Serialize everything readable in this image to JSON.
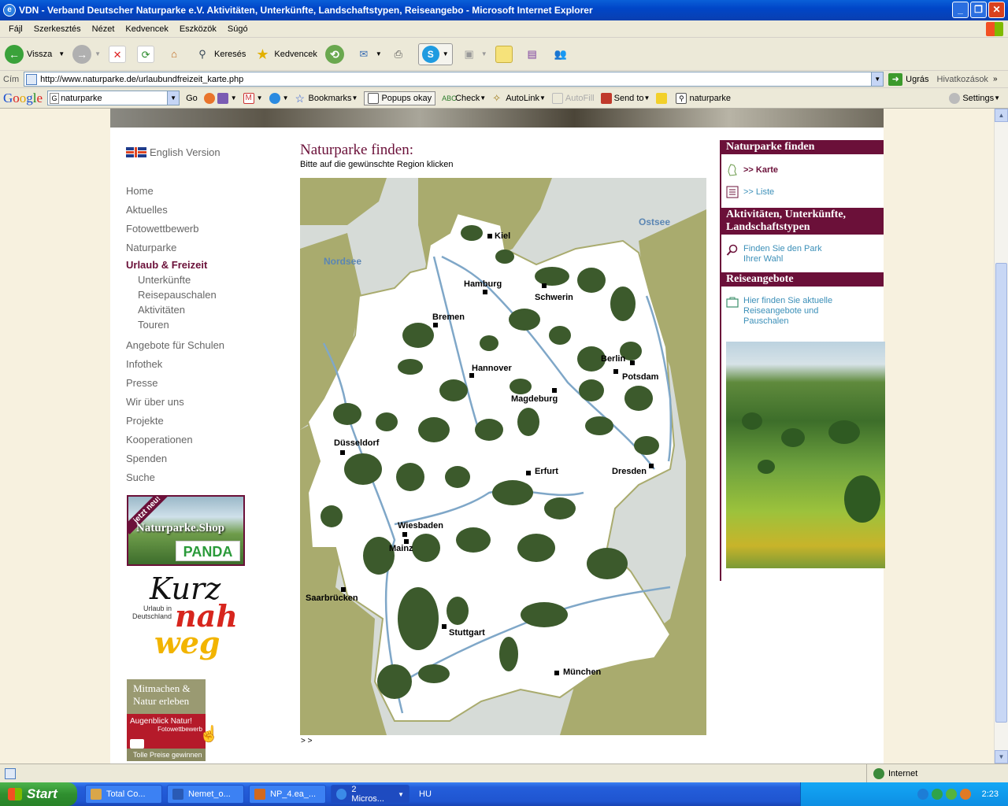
{
  "window": {
    "title": "VDN - Verband Deutscher Naturparke e.V. Aktivitäten, Unterkünfte, Landschaftstypen, Reiseangebo - Microsoft Internet Explorer"
  },
  "menu": [
    "Fájl",
    "Szerkesztés",
    "Nézet",
    "Kedvencek",
    "Eszközök",
    "Súgó"
  ],
  "toolbar": {
    "back": "Vissza",
    "search": "Keresés",
    "favorites": "Kedvencek"
  },
  "address": {
    "label": "Cím",
    "url": "http://www.naturparke.de/urlaubundfreizeit_karte.php",
    "go": "Ugrás",
    "links": "Hivatkozások"
  },
  "google_toolbar": {
    "search_value": "naturparke",
    "go": "Go",
    "bookmarks": "Bookmarks",
    "popups": "Popups okay",
    "check": "Check",
    "autolink": "AutoLink",
    "autofill": "AutoFill",
    "sendto": "Send to",
    "highlight_term": "naturparke",
    "settings": "Settings"
  },
  "left_nav": {
    "english": "English Version",
    "items": [
      "Home",
      "Aktuelles",
      "Fotowettbewerb",
      "Naturparke"
    ],
    "active": "Urlaub & Freizeit",
    "sub": [
      "Unterkünfte",
      "Reisepauschalen",
      "Aktivitäten",
      "Touren"
    ],
    "items2": [
      "Angebote für Schulen",
      "Infothek",
      "Presse",
      "Wir über uns",
      "Projekte",
      "Kooperationen",
      "Spenden",
      "Suche"
    ]
  },
  "banners": {
    "shop_new": "jetzt neu!",
    "shop_title": "Naturparke.Shop",
    "panda": "PANDA",
    "kurz1": "Kurz",
    "kurz2": "nah",
    "kurz3": "weg",
    "kurz_sub": "Urlaub in Deutschland",
    "mit_title": "Mitmachen & Natur erleben",
    "mit_red": "Augenblick Natur!",
    "mit_red2": "Fotowettbewerb",
    "mit_bottom": "Tolle Preise gewinnen"
  },
  "main": {
    "title": "Naturparke finden:",
    "subtitle": "Bitte auf die gewünschte Region klicken",
    "footer": "> >"
  },
  "map": {
    "seas": [
      "Nordsee",
      "Ostsee"
    ],
    "cities": [
      {
        "name": "Kiel"
      },
      {
        "name": "Hamburg"
      },
      {
        "name": "Schwerin"
      },
      {
        "name": "Bremen"
      },
      {
        "name": "Berlin"
      },
      {
        "name": "Potsdam"
      },
      {
        "name": "Hannover"
      },
      {
        "name": "Magdeburg"
      },
      {
        "name": "Düsseldorf"
      },
      {
        "name": "Erfurt"
      },
      {
        "name": "Dresden"
      },
      {
        "name": "Wiesbaden"
      },
      {
        "name": "Mainz"
      },
      {
        "name": "Saarbrücken"
      },
      {
        "name": "Stuttgart"
      },
      {
        "name": "München"
      }
    ]
  },
  "right": {
    "h1": "Naturparke finden",
    "karte": ">> Karte",
    "liste": ">> Liste",
    "h2": "Aktivitäten, Unterkünfte, Landschaftstypen",
    "find_park": "Finden Sie den Park Ihrer Wahl",
    "h3": "Reiseangebote",
    "offers": "Hier finden Sie aktuelle Reiseangebote und Pauschalen"
  },
  "status": {
    "zone": "Internet"
  },
  "taskbar": {
    "start": "Start",
    "tasks": [
      "Total Co...",
      "Nemet_o...",
      "NP_4.ea_...",
      "2 Micros..."
    ],
    "lang": "HU",
    "clock": "2:23"
  },
  "colors": {
    "brand": "#6b1039",
    "link": "#3b8fb8",
    "park_green": "#3c5a2c",
    "land_olive": "#a9ab6e",
    "sea": "#d6dbd7"
  }
}
